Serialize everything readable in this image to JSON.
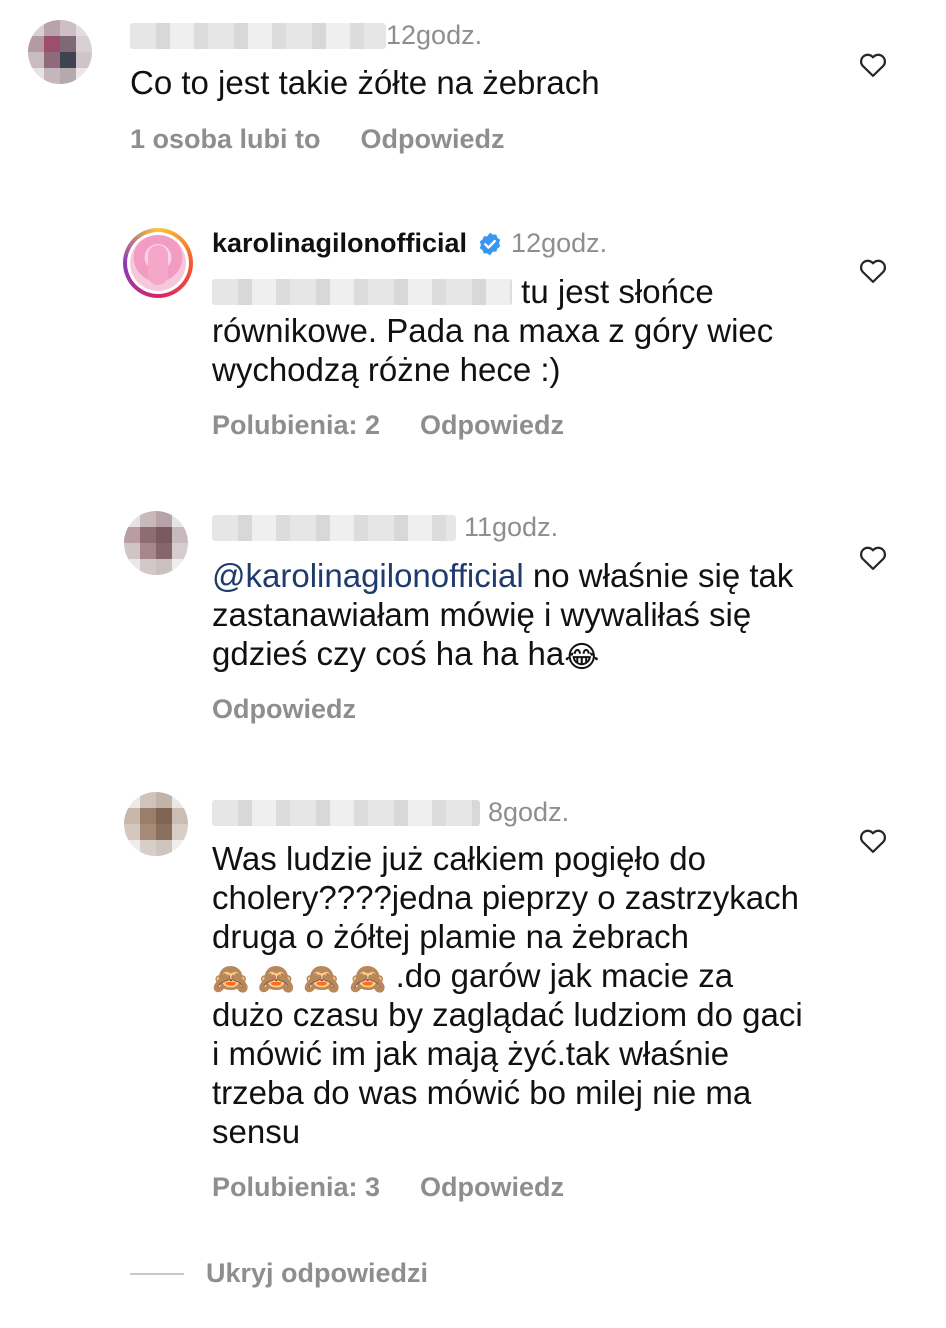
{
  "comments": [
    {
      "username_visible": "",
      "blurred": true,
      "time": "12godz.",
      "text": "Co to jest takie żółte na żebrach",
      "likes": "1 osoba lubi to",
      "reply": "Odpowiedz"
    },
    {
      "username_visible": "karolinagilonofficial",
      "verified": true,
      "time": "12godz.",
      "text_line1_suffix": "tu jest słońce",
      "text_rest": "równikowe. Pada na maxa z góry wiec wychodzą różne hece :)",
      "likes": "Polubienia: 2",
      "reply": "Odpowiedz"
    },
    {
      "time": "11godz.",
      "mention": "@karolinagilonofficial",
      "text": " no właśnie się tak zastanawiałam mówię i wywaliłaś się gdzieś czy coś ha ha ha",
      "emoji": "😂",
      "reply": "Odpowiedz"
    },
    {
      "time": "8godz.",
      "text_part1": "Was ludzie już całkiem pogięło do cholery????jedna pieprzy o zastrzykach druga o żółtej plamie na żebrach ",
      "emoji": "🙈 🙈 🙈 🙈",
      "text_part2": " .do garów jak macie za dużo czasu by zaglądać ludziom do gaci i mówić im jak mają żyć.tak właśnie trzeba do was mówić bo milej nie ma sensu",
      "likes": "Polubienia: 3",
      "reply": "Odpowiedz"
    }
  ],
  "hide_replies": "Ukryj odpowiedzi",
  "icons": {
    "like": "heart-icon",
    "verified": "verified-badge-icon"
  },
  "colors": {
    "meta": "#8e8e8e",
    "mention": "#1f3b6d",
    "verified": "#3897f0"
  }
}
